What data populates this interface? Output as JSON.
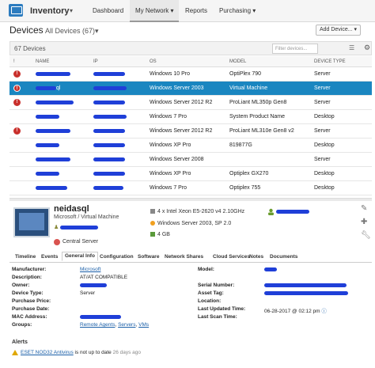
{
  "header": {
    "app_name": "Inventory",
    "nav": [
      "Dashboard",
      "My Network",
      "Reports",
      "Purchasing"
    ],
    "active_nav": "My Network"
  },
  "page": {
    "title": "Devices",
    "subtitle": "All Devices (67)",
    "add_button": "Add Device...",
    "count": "67 Devices",
    "filter_placeholder": "Filter devices..."
  },
  "table": {
    "columns": [
      "NAME",
      "IP",
      "OS",
      "MODEL",
      "DEVICE TYPE"
    ],
    "rows": [
      {
        "alert": true,
        "name_suffix": "",
        "os": "Windows 10 Pro",
        "model": "OptiPlex 790",
        "type": "Server",
        "selected": false
      },
      {
        "alert": true,
        "name_suffix": "ql",
        "os": "Windows Server 2003",
        "model": "Virtual Machine",
        "type": "Server",
        "selected": true
      },
      {
        "alert": true,
        "name_suffix": "",
        "os": "Windows Server 2012 R2",
        "model": "ProLiant ML350p Gen8",
        "type": "Server",
        "selected": false
      },
      {
        "alert": false,
        "name_suffix": "",
        "os": "Windows 7 Pro",
        "model": "System Product Name",
        "type": "Desktop",
        "selected": false
      },
      {
        "alert": true,
        "name_suffix": "",
        "os": "Windows Server 2012 R2",
        "model": "ProLiant ML310e Gen8 v2",
        "type": "Server",
        "selected": false
      },
      {
        "alert": false,
        "name_suffix": "",
        "os": "Windows XP Pro",
        "model": "819877G",
        "type": "Desktop",
        "selected": false
      },
      {
        "alert": false,
        "name_suffix": "",
        "os": "Windows Server 2008",
        "model": "",
        "type": "Server",
        "selected": false
      },
      {
        "alert": false,
        "name_suffix": "",
        "os": "Windows XP Pro",
        "model": "Optiplex GX270",
        "type": "Desktop",
        "selected": false
      },
      {
        "alert": false,
        "name_suffix": "",
        "os": "Windows 7 Pro",
        "model": "Optiplex 755",
        "type": "Desktop",
        "selected": false
      }
    ]
  },
  "details": {
    "name": "neidasql",
    "type": "Microsoft / Virtual Machine",
    "site": "Central Server",
    "cpu": "4 x Intel Xeon E5-2620 v4 2.10GHz",
    "os": "Windows Server 2003, SP 2.0",
    "ram": "4 GB"
  },
  "tabs": [
    "Timeline",
    "Events",
    "General Info",
    "Configuration",
    "Software",
    "Network Shares",
    "Cloud Services",
    "Notes",
    "Documents"
  ],
  "active_tab": "General Info",
  "general_info": {
    "manufacturer_label": "Manufacturer:",
    "manufacturer": "Microsoft",
    "description_label": "Description:",
    "description": "AT/AT COMPATIBLE",
    "owner_label": "Owner:",
    "device_type_label": "Device Type:",
    "device_type": "Server",
    "purchase_price_label": "Purchase Price:",
    "purchase_date_label": "Purchase Date:",
    "mac_label": "MAC Address:",
    "groups_label": "Groups:",
    "groups": [
      "Remote Agents",
      "Servers",
      "VMs"
    ],
    "model_label": "Model:",
    "serial_label": "Serial Number:",
    "asset_tag_label": "Asset Tag:",
    "location_label": "Location:",
    "last_updated_label": "Last Updated Time:",
    "last_updated": "06-28-2017 @ 02:12 pm",
    "last_scan_label": "Last Scan Time:"
  },
  "alerts": {
    "heading": "Alerts",
    "items": [
      {
        "product": "ESET NOD32 Antivirus",
        "message": "is not up to date",
        "age": "26 days ago"
      }
    ]
  },
  "colors": {
    "accent": "#1a86c0",
    "alert": "#c9302c",
    "redaction": "#1f3fd8"
  }
}
